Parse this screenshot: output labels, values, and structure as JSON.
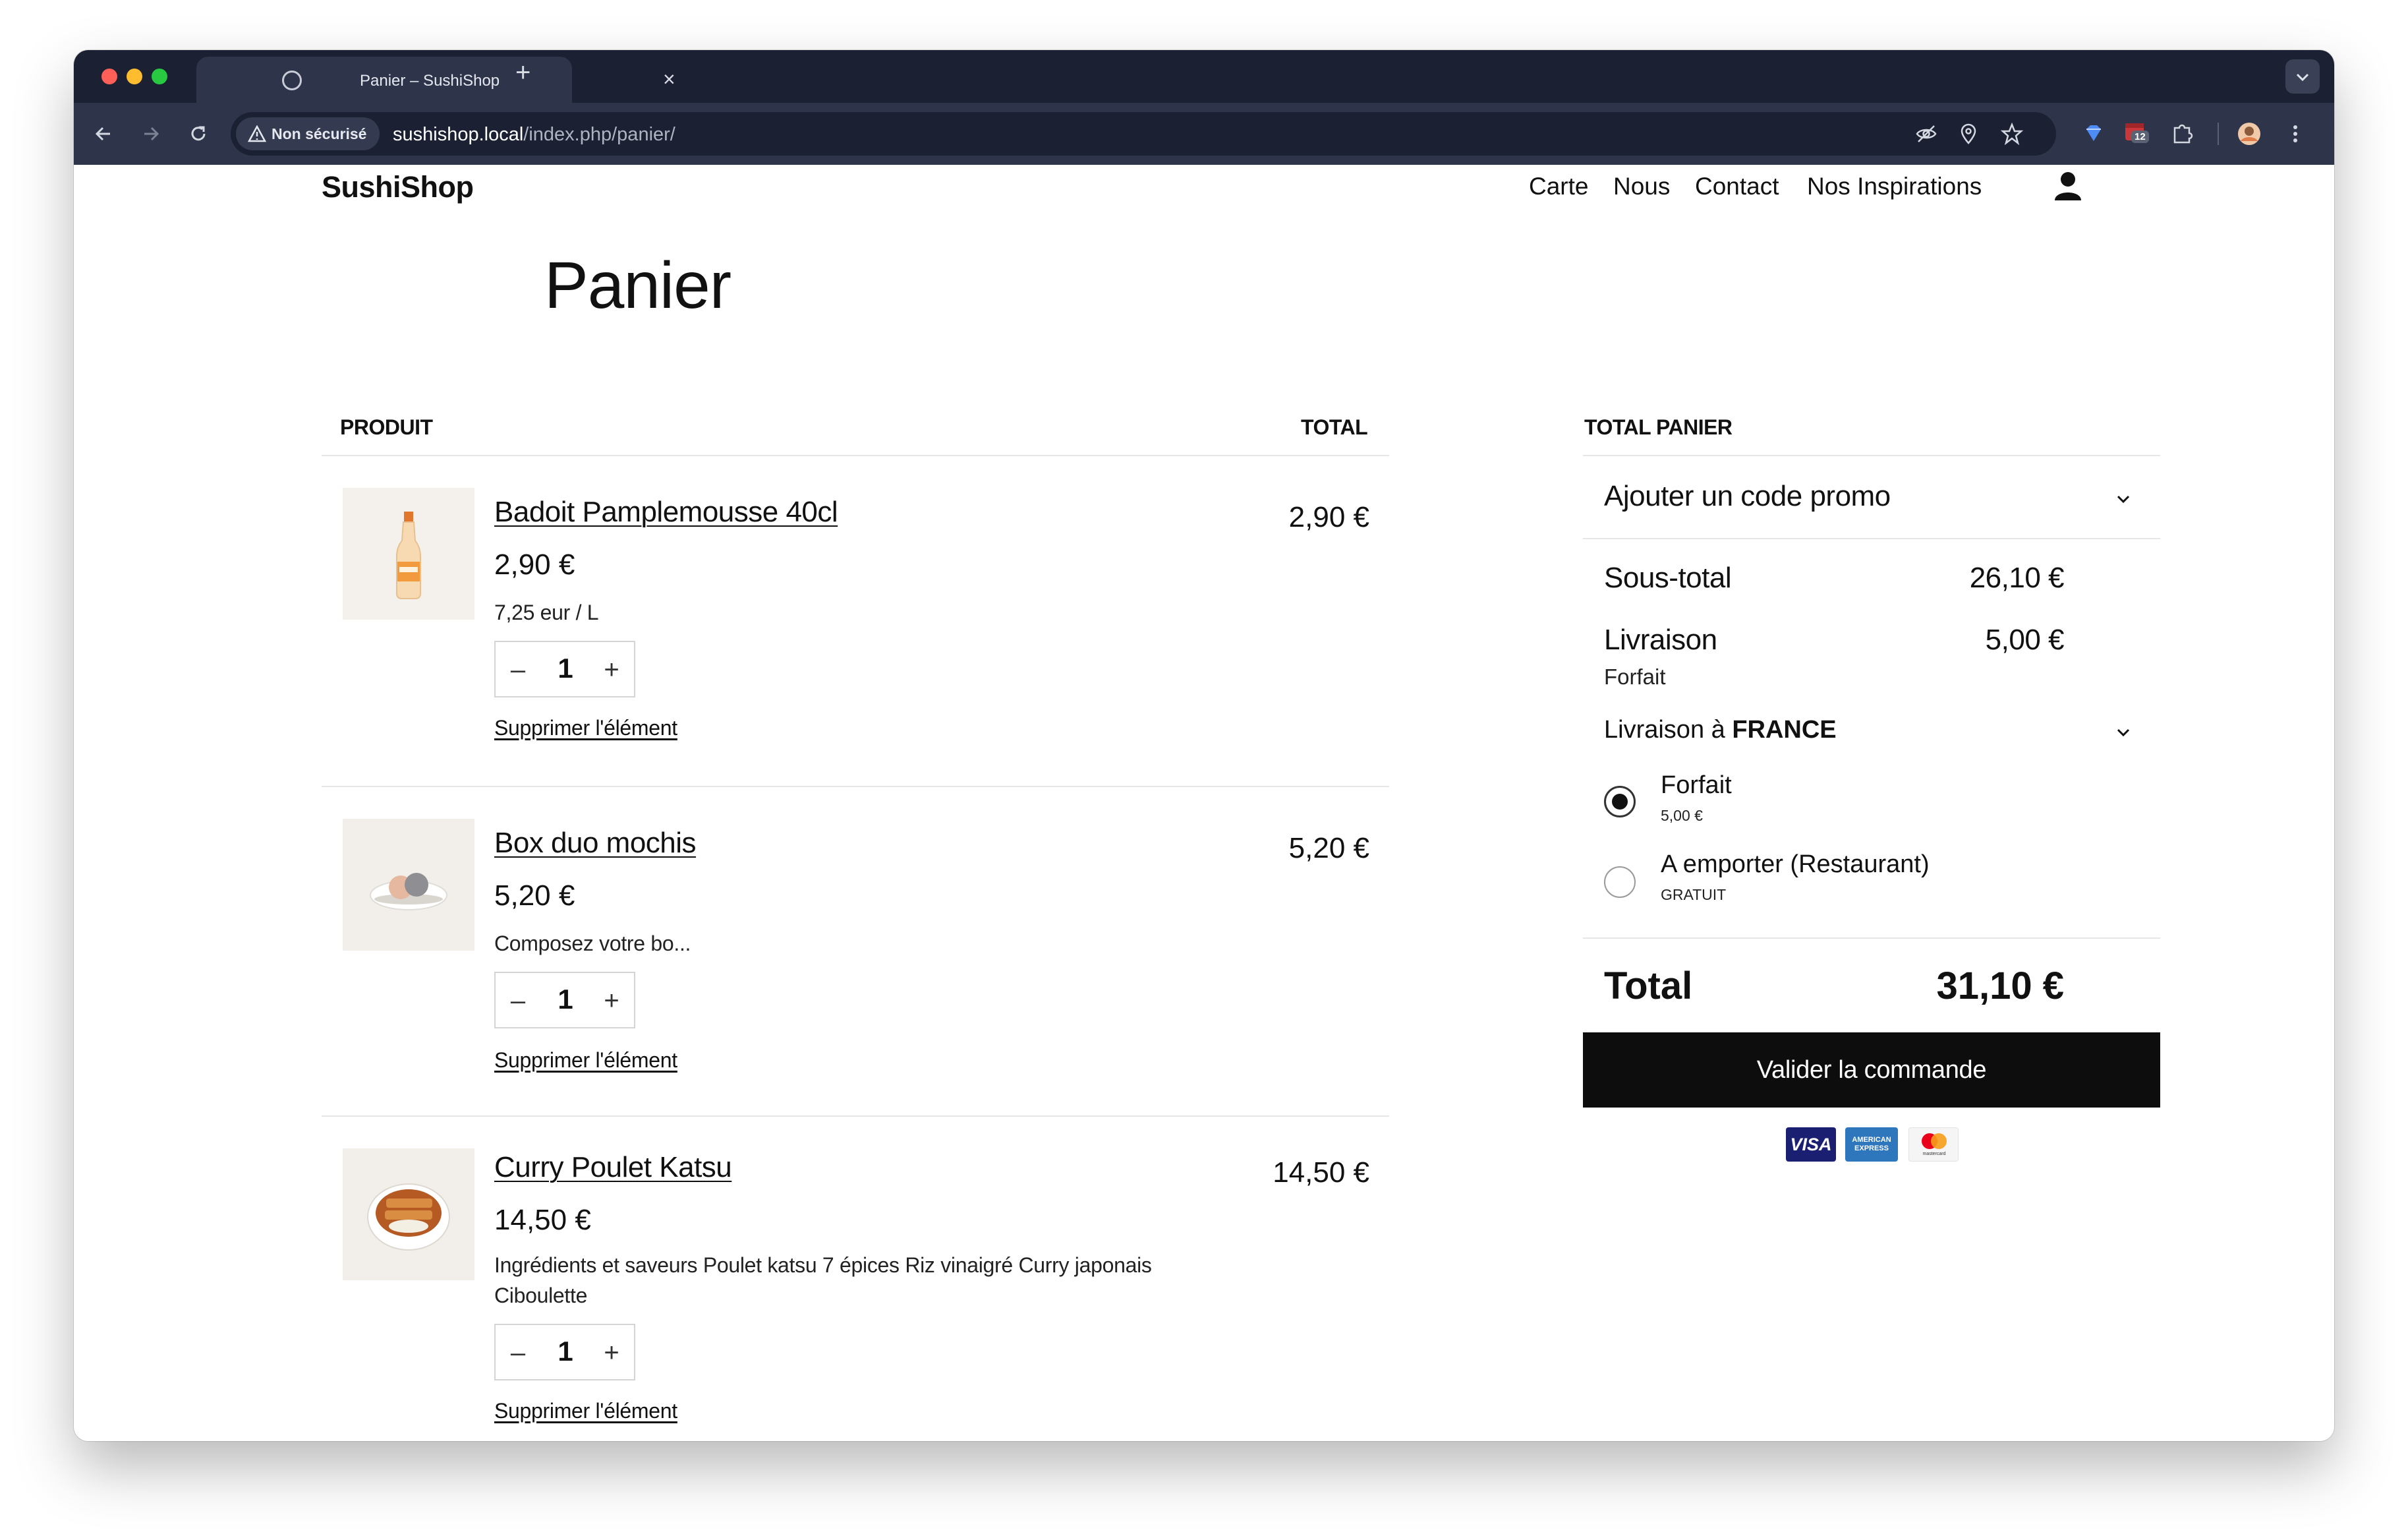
{
  "browser": {
    "tab_title": "Panier – SushiShop",
    "tab_close": "×",
    "new_tab": "+",
    "tab_menu": "⌄",
    "security_label": "Non sécurisé",
    "url_host": "sushishop.local",
    "url_path": "/index.php/panier/",
    "extension_badge": "12"
  },
  "site": {
    "brand": "SushiShop",
    "nav": [
      "Carte",
      "Nous",
      "Contact",
      "Nos Inspirations"
    ]
  },
  "cart": {
    "title": "Panier",
    "col_product": "PRODUIT",
    "col_total": "TOTAL",
    "remove_label": "Supprimer l'élément",
    "items": [
      {
        "name": "Badoit Pamplemousse 40cl",
        "price": "2,90 €",
        "desc": "7,25 eur / L",
        "qty": "1",
        "total": "2,90 €",
        "image": "bottle"
      },
      {
        "name": "Box duo mochis",
        "price": "5,20 €",
        "desc": "Composez votre bo...",
        "qty": "1",
        "total": "5,20 €",
        "image": "mochi"
      },
      {
        "name": "Curry Poulet Katsu",
        "price": "14,50 €",
        "desc": "Ingrédients et saveurs Poulet katsu 7 épices Riz vinaigré Curry japonais Ciboulette",
        "qty": "1",
        "total": "14,50 €",
        "image": "curry-bowl"
      }
    ]
  },
  "summary": {
    "heading": "TOTAL PANIER",
    "promo_label": "Ajouter un code promo",
    "subtotal_label": "Sous-total",
    "subtotal_value": "26,10 €",
    "shipping_label": "Livraison",
    "shipping_value": "5,00 €",
    "shipping_method": "Forfait",
    "shipping_to_prefix": "Livraison à ",
    "shipping_country": "FRANCE",
    "options": [
      {
        "label": "Forfait",
        "price": "5,00 €",
        "selected": true
      },
      {
        "label": "A emporter (Restaurant)",
        "price": "GRATUIT",
        "selected": false
      }
    ],
    "total_label": "Total",
    "total_value": "31,10 €",
    "checkout_label": "Valider la commande",
    "cards": [
      {
        "name": "VISA",
        "color": "#1a1f71"
      },
      {
        "name": "AMERICAN EXPRESS",
        "color": "#2e77bc"
      },
      {
        "name": "mastercard",
        "color": "#eb001b"
      }
    ]
  }
}
